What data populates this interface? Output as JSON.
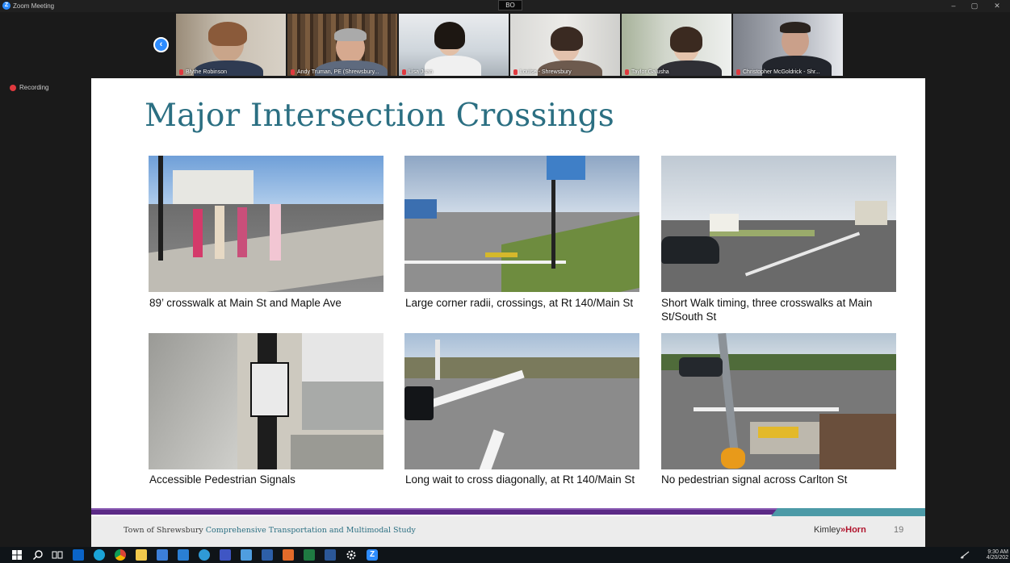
{
  "window": {
    "app_title": "Zoom Meeting",
    "speaker_tag": "BO",
    "controls": [
      "–",
      "▢",
      "✕"
    ]
  },
  "recording": {
    "label": "Recording"
  },
  "participants": [
    {
      "name": "Blythe Robinson"
    },
    {
      "name": "Andy Truman, PE (Shrewsbury..."
    },
    {
      "name": "Lisa Juan"
    },
    {
      "name": "Louise - Shrewsbury"
    },
    {
      "name": "Taylor Galusha"
    },
    {
      "name": "Christopher McGoldrick - Shr..."
    }
  ],
  "slide": {
    "title": "Major Intersection Crossings",
    "photos": [
      {
        "caption": "89’ crosswalk at Main St and Maple Ave"
      },
      {
        "caption": "Large corner radii, crossings, at Rt 140/Main St"
      },
      {
        "caption": "Short Walk timing, three crosswalks at Main St/South St"
      },
      {
        "caption": "Accessible Pedestrian Signals"
      },
      {
        "caption": "Long wait to cross diagonally, at Rt 140/Main St"
      },
      {
        "caption": "No pedestrian signal across Carlton St"
      }
    ],
    "footer": {
      "org": "Town of Shrewsbury",
      "study": "Comprehensive Transportation and Multimodal Study",
      "brand_left": "Kimley",
      "brand_symbol": "»",
      "brand_right": "Horn",
      "page_number": "19"
    }
  },
  "taskbar": {
    "icons": [
      "windows-icon",
      "search-icon",
      "task-view-icon",
      "outlook-icon",
      "edge-icon",
      "chrome-icon",
      "file-explorer-icon",
      "store-icon",
      "mail-icon",
      "app-icon",
      "app-icon",
      "app-icon",
      "app-icon",
      "app-icon",
      "excel-icon",
      "word-icon",
      "settings-icon",
      "zoom-icon"
    ],
    "time": "9:30 AM",
    "date": "4/20/202"
  },
  "colors": {
    "title": "#2b6f82",
    "zoom_blue": "#2d8cff",
    "band_purple": "#5b2a86",
    "band_teal": "#4c9aa7",
    "brand_red": "#b0132c"
  }
}
